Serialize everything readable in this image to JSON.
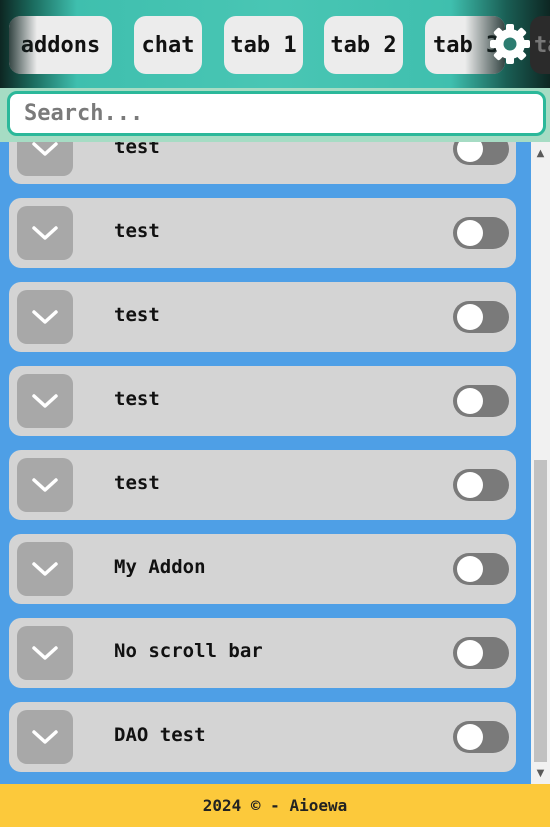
{
  "tabs": [
    {
      "label": "addons"
    },
    {
      "label": "chat"
    },
    {
      "label": "tab 1"
    },
    {
      "label": "tab 2"
    },
    {
      "label": "tab 3"
    },
    {
      "label": "ta"
    }
  ],
  "settings_icon": "gear-icon",
  "search": {
    "placeholder": "Search...",
    "value": ""
  },
  "addons": [
    {
      "label": "test",
      "enabled": false
    },
    {
      "label": "test",
      "enabled": false
    },
    {
      "label": "test",
      "enabled": false
    },
    {
      "label": "test",
      "enabled": false
    },
    {
      "label": "test",
      "enabled": false
    },
    {
      "label": "My Addon",
      "enabled": false
    },
    {
      "label": "No scroll bar",
      "enabled": false
    },
    {
      "label": "DAO test",
      "enabled": false
    }
  ],
  "footer": {
    "text": "2024 © - Aioewa"
  },
  "colors": {
    "tabbar": "#49c6b4",
    "search_border": "#2bb89a",
    "list_background": "#4e9fe6",
    "row_background": "#d4d4d4",
    "footer": "#fcc93b"
  }
}
